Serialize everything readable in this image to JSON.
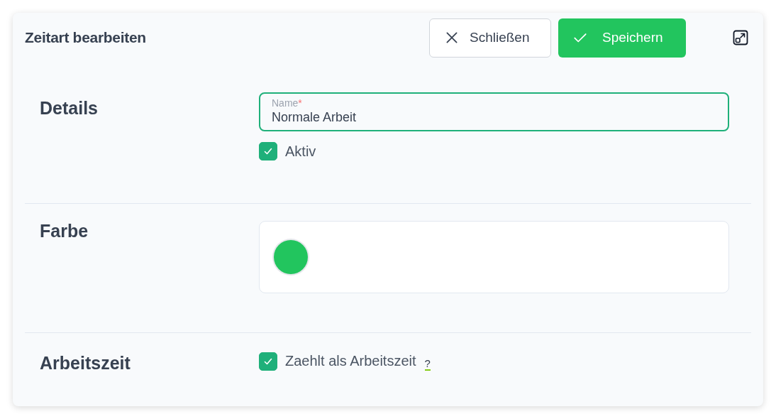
{
  "dialog": {
    "title": "Zeitart bearbeiten",
    "buttons": [
      {
        "kind": "close",
        "label": "Schließen"
      },
      {
        "kind": "save",
        "label": "Speichern"
      }
    ]
  },
  "sections": [
    {
      "kind": "details",
      "heading": "Details",
      "field": {
        "label": "Name",
        "required_mark": "*",
        "value": "Normale Arbeit",
        "focused": true
      },
      "checkbox": {
        "label": "Aktiv",
        "checked": true
      }
    },
    {
      "kind": "color",
      "heading": "Farbe",
      "color": "#22c55e"
    },
    {
      "kind": "worktime",
      "heading": "Arbeitszeit",
      "checkbox": {
        "label": "Zaehlt als Arbeitszeit",
        "checked": true
      },
      "help": "?"
    }
  ]
}
